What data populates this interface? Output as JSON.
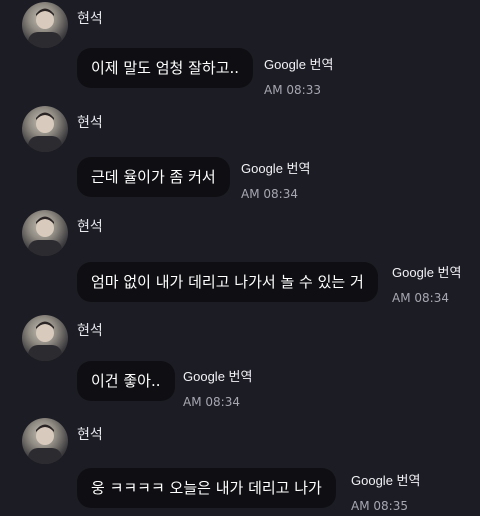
{
  "messages": [
    {
      "sender": "현석",
      "text": "이제 말도 엄청 잘하고..",
      "translate": "Google 번역",
      "time": "AM 08:33"
    },
    {
      "sender": "현석",
      "text": "근데 율이가 좀 커서",
      "translate": "Google 번역",
      "time": "AM 08:34"
    },
    {
      "sender": "현석",
      "text": "엄마 없이 내가 데리고 나가서 놀 수 있는 거",
      "translate": "Google 번역",
      "time": "AM 08:34"
    },
    {
      "sender": "현석",
      "text": "이건 좋아..",
      "translate": "Google 번역",
      "time": "AM 08:34"
    },
    {
      "sender": "현석",
      "text": "웅 ㅋㅋㅋㅋ 오늘은 내가 데리고 나가",
      "translate": "Google 번역",
      "time": "AM 08:35"
    }
  ]
}
